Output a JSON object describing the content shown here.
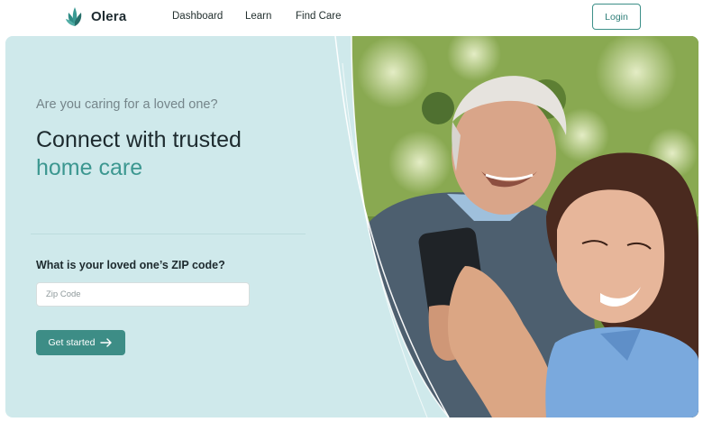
{
  "header": {
    "brand": "Olera",
    "nav": [
      "Dashboard",
      "Learn",
      "Find Care"
    ],
    "login_label": "Login"
  },
  "hero": {
    "question": "Are you caring for a loved one?",
    "headline_line1": "Connect with trusted",
    "headline_accent": "home care",
    "zip_label": "What is your loved one’s ZIP code?",
    "zip_placeholder": "Zip Code",
    "cta_label": "Get started"
  },
  "colors": {
    "accent": "#3c9790",
    "hero_background": "#cfe9eb",
    "button": "#3d8d86"
  },
  "icons": [
    "leaf-logo-icon",
    "arrow-right-icon"
  ]
}
